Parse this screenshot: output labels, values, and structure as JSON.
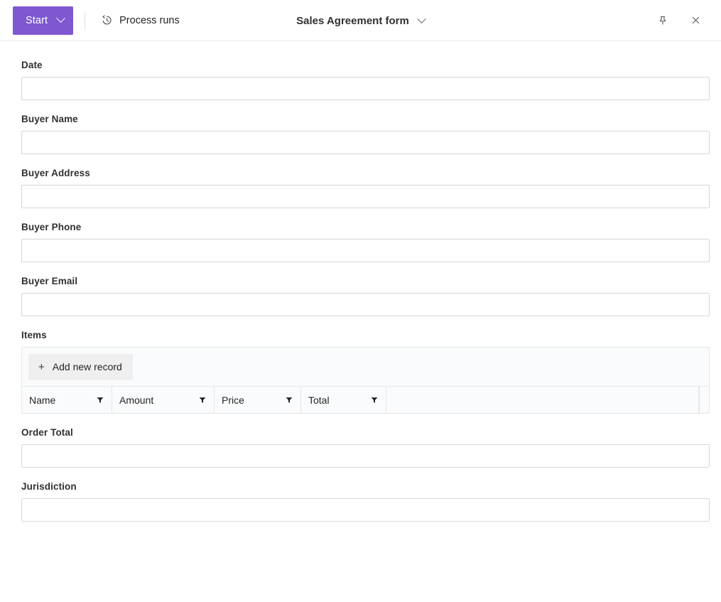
{
  "window": {
    "pin_icon": "pin-icon",
    "close_icon": "close-icon"
  },
  "toolbar": {
    "start_label": "Start",
    "start_chevron_icon": "chevron-down-icon",
    "process_runs_label": "Process runs",
    "process_runs_icon": "history-icon"
  },
  "header": {
    "title": "Sales Agreement form",
    "title_chevron_icon": "chevron-down-icon"
  },
  "form": {
    "fields": [
      {
        "label": "Date",
        "value": "",
        "placeholder": ""
      },
      {
        "label": "Buyer Name",
        "value": "",
        "placeholder": ""
      },
      {
        "label": "Buyer Address",
        "value": "",
        "placeholder": ""
      },
      {
        "label": "Buyer Phone",
        "value": "",
        "placeholder": ""
      },
      {
        "label": "Buyer Email",
        "value": "",
        "placeholder": ""
      }
    ],
    "items_section": {
      "label": "Items",
      "add_record_label": "Add new record",
      "add_record_icon": "plus-icon",
      "columns": [
        {
          "label": "Name",
          "filter_icon": "filter-icon"
        },
        {
          "label": "Amount",
          "filter_icon": "filter-icon"
        },
        {
          "label": "Price",
          "filter_icon": "filter-icon"
        },
        {
          "label": "Total",
          "filter_icon": "filter-icon"
        }
      ],
      "rows": []
    },
    "trailing_fields": [
      {
        "label": "Order Total",
        "value": "",
        "placeholder": ""
      },
      {
        "label": "Jurisdiction",
        "value": "",
        "placeholder": ""
      }
    ]
  },
  "colors": {
    "accent": "#7e57d1",
    "border": "#d6d6d6",
    "grid_border": "#e6e6e6",
    "button_bg": "#efefef",
    "text": "#252423"
  }
}
